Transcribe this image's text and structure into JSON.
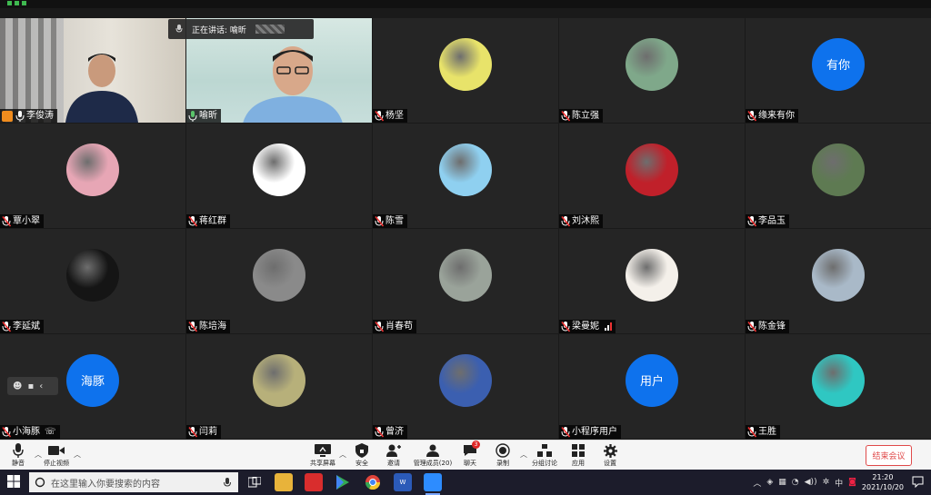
{
  "speaking_banner": "正在讲话: 喻昕",
  "participants": [
    {
      "name": "李俊涛",
      "kind": "video1",
      "mic": "on",
      "host": true
    },
    {
      "name": "喻昕",
      "kind": "video2",
      "mic": "on",
      "speaking": true
    },
    {
      "name": "杨坚",
      "kind": "avatar",
      "mic": "muted",
      "avatar_icon": "photo-avatar-icon",
      "color": "#e8e36a"
    },
    {
      "name": "陈立强",
      "kind": "avatar",
      "mic": "muted",
      "avatar_icon": "landscape-avatar-icon",
      "color": "#7fa88a"
    },
    {
      "name": "缘来有你",
      "kind": "text",
      "mic": "muted",
      "avatar_text": "有你"
    },
    {
      "name": "覃小翠",
      "kind": "avatar",
      "mic": "muted",
      "avatar_icon": "flowers-avatar-icon",
      "color": "#e7a6b5"
    },
    {
      "name": "蒋红群",
      "kind": "avatar",
      "mic": "muted",
      "avatar_icon": "logo-avatar-icon",
      "color": "#ffffff"
    },
    {
      "name": "陈雪",
      "kind": "avatar",
      "mic": "muted",
      "avatar_icon": "cartoon-sky-avatar-icon",
      "color": "#8fd0f0"
    },
    {
      "name": "刘沐熙",
      "kind": "avatar",
      "mic": "muted",
      "avatar_icon": "lucky-cat-avatar-icon",
      "color": "#c0202a"
    },
    {
      "name": "李品玉",
      "kind": "avatar",
      "mic": "muted",
      "avatar_icon": "child-photo-avatar-icon",
      "color": "#5e7a52"
    },
    {
      "name": "李延斌",
      "kind": "avatar",
      "mic": "muted",
      "avatar_icon": "vase-avatar-icon",
      "color": "#151515"
    },
    {
      "name": "陈培海",
      "kind": "avatar",
      "mic": "muted",
      "avatar_icon": "man-photo-avatar-icon",
      "color": "#8a8a8a"
    },
    {
      "name": "肖春苟",
      "kind": "avatar",
      "mic": "muted",
      "avatar_icon": "mountain-avatar-icon",
      "color": "#9aa39a"
    },
    {
      "name": "梁曼妮",
      "kind": "avatar",
      "mic": "muted",
      "avatar_icon": "pastry-avatar-icon",
      "color": "#f4f0ea",
      "signal": true
    },
    {
      "name": "陈金锋",
      "kind": "avatar",
      "mic": "muted",
      "avatar_icon": "seaside-avatar-icon",
      "color": "#a9b9c8"
    },
    {
      "name": "小海豚",
      "kind": "text",
      "mic": "muted",
      "avatar_text": "海豚",
      "extra_icon": true
    },
    {
      "name": "闫莉",
      "kind": "avatar",
      "mic": "muted",
      "avatar_icon": "woman-photo-avatar-icon",
      "color": "#b7b07a"
    },
    {
      "name": "曾济",
      "kind": "avatar",
      "mic": "muted",
      "avatar_icon": "toy-avatar-icon",
      "color": "#3b5fb0"
    },
    {
      "name": "小程序用户",
      "kind": "text",
      "mic": "muted",
      "avatar_text": "用户"
    },
    {
      "name": "王胜",
      "kind": "avatar",
      "mic": "muted",
      "avatar_icon": "flower-vase-avatar-icon",
      "color": "#2fc7c2"
    }
  ],
  "toolbar": {
    "mute": "静音",
    "stop_video": "停止视频",
    "share": "共享屏幕",
    "security": "安全",
    "invite": "邀请",
    "manage": "管理成员(20)",
    "chat": "聊天",
    "chat_badge": "3",
    "record": "录制",
    "breakout": "分组讨论",
    "apps": "应用",
    "settings": "设置",
    "end": "结束会议"
  },
  "taskbar": {
    "search_placeholder": "在这里输入你要搜索的内容",
    "ime": "中",
    "time": "21:20",
    "date": "2021/10/20"
  },
  "colors": {
    "accent": "#0e72ed",
    "speaking": "#5ac36a",
    "end": "#e04a4a"
  }
}
